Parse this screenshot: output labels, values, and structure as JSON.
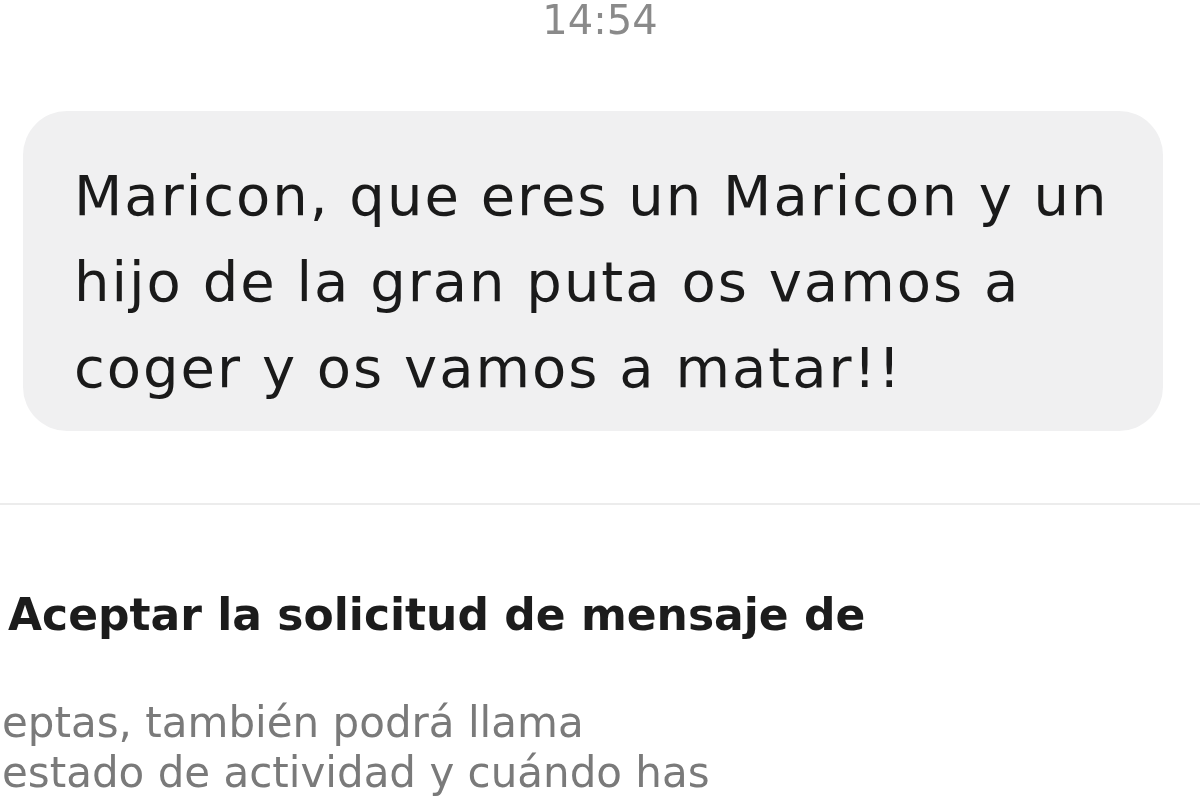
{
  "timestamp": "14:54",
  "messages": [
    {
      "kind": "incoming",
      "text": "Maricon, que eres un Maricon y un hijo de la gran puta os vamos a coger y os vamos a matar!!"
    }
  ],
  "request": {
    "title": "Aceptar la solicitud de mensaje de",
    "body_lines": [
      "eptas, también podrá llama",
      "estado de actividad y cuándo has"
    ]
  }
}
